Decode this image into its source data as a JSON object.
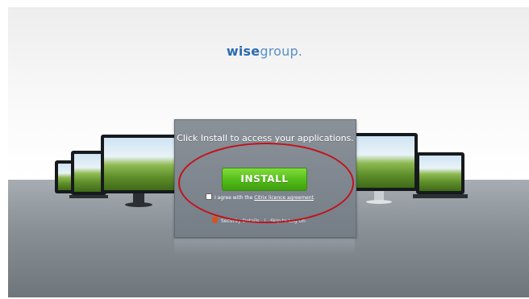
{
  "brand": {
    "bold": "wise",
    "light": "group."
  },
  "panel": {
    "message": "Click Install to access your applications.",
    "install_label": "INSTALL",
    "agree_prefix": "I agree with the ",
    "agree_link": "Citrix licence agreement",
    "agree_suffix": ".",
    "security_label": "Security Details",
    "separator": "|",
    "skip_label": "Skip to Log On"
  },
  "colors": {
    "brand_blue": "#2c6cb0",
    "install_green": "#53bb19",
    "panel_gray": "#7f868e",
    "highlight_ring": "#c2121a"
  },
  "icons": {
    "security": "shield-icon"
  }
}
